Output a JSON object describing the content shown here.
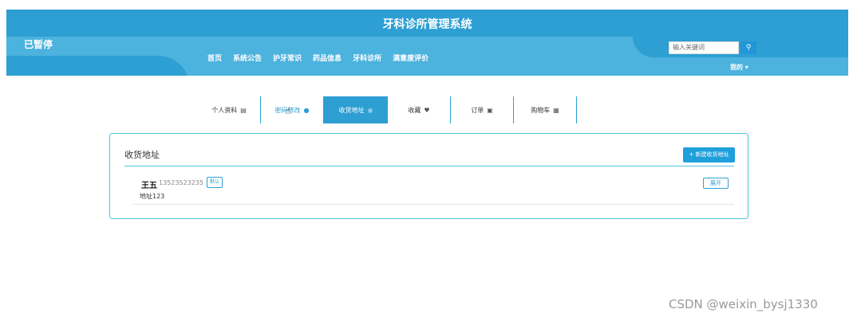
{
  "app_title": "牙科诊所管理系统",
  "status_badge": "已暂停",
  "nav": [
    "首页",
    "系统公告",
    "护牙常识",
    "药品信息",
    "牙科诊所",
    "满意度评价"
  ],
  "search": {
    "placeholder": "输入关键词",
    "button_icon": "search-icon"
  },
  "user_menu": {
    "label": "我的",
    "icon": "chevron-down-icon"
  },
  "tabs": [
    {
      "label": "个人资料",
      "icon": "user-card-icon"
    },
    {
      "label": "密码修改",
      "icon": "person-icon"
    },
    {
      "label": "收货地址",
      "icon": "location-icon",
      "active": true
    },
    {
      "label": "收藏",
      "icon": "heart-icon"
    },
    {
      "label": "订单",
      "icon": "document-icon"
    },
    {
      "label": "购物车",
      "icon": "cart-icon"
    }
  ],
  "address_panel": {
    "title": "收货地址",
    "new_button": "+ 新建收货地址",
    "items": [
      {
        "name": "王五",
        "phone": "13523523235",
        "badge": "默认",
        "address": "地址123",
        "action": "展开"
      }
    ]
  },
  "watermark": "CSDN @weixin_bysj1330",
  "colors": {
    "primary": "#2d9fd3",
    "header_dark": "#2d9fd3",
    "header_light": "#4cb2de",
    "border": "#4cc3db"
  }
}
